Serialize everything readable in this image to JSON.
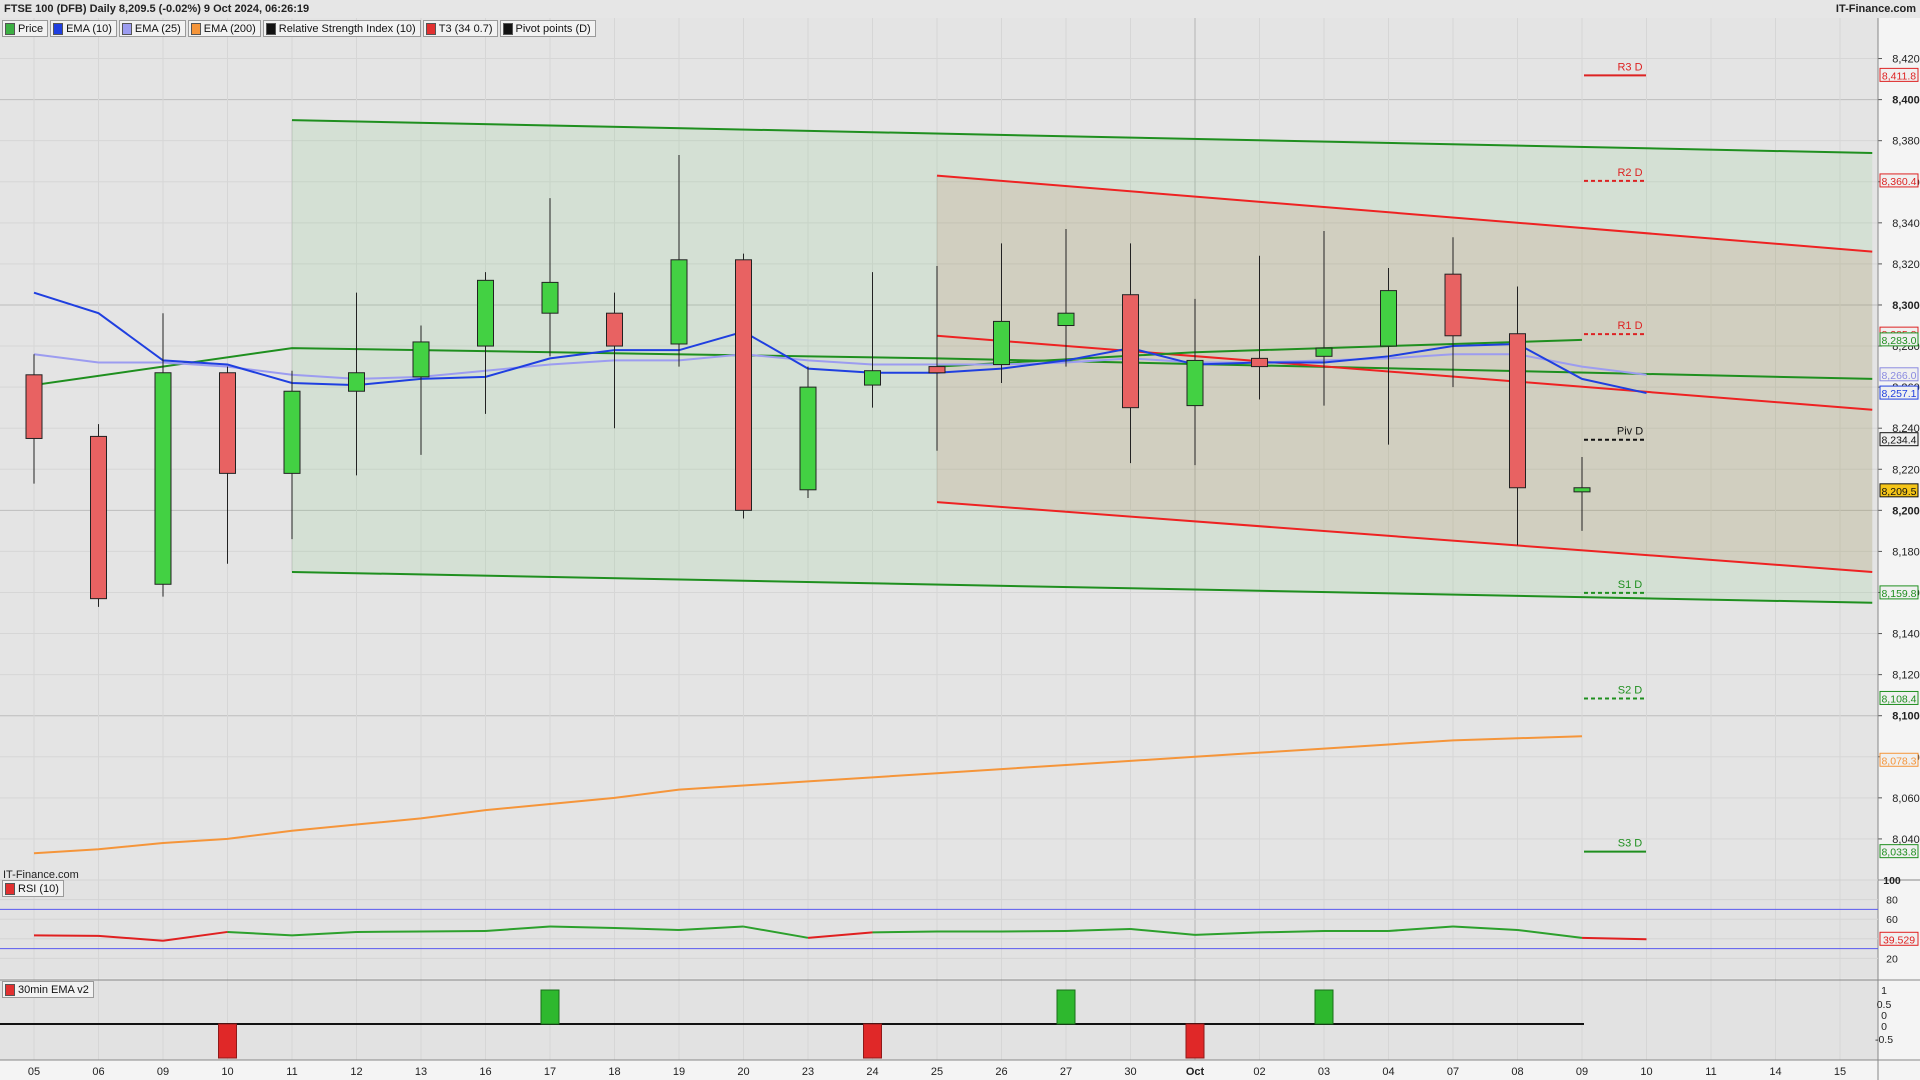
{
  "header": {
    "title": "FTSE 100 (DFB) Daily 8,209.5 (-0.02%) 9 Oct 2024, 06:26:19",
    "brand": "IT-Finance.com",
    "watermark": "IT-Finance.com"
  },
  "legend": [
    {
      "label": "Price",
      "color": "#3cb043"
    },
    {
      "label": "EMA (10)",
      "color": "#1f3fe0"
    },
    {
      "label": "EMA (25)",
      "color": "#9c9cf0"
    },
    {
      "label": "EMA (200)",
      "color": "#f5953a"
    },
    {
      "label": "Relative Strength Index (10)",
      "color": "#111111"
    },
    {
      "label": "T3 (34 0.7)",
      "color": "#e23030"
    },
    {
      "label": "Pivot points (D)",
      "color": "#111111"
    }
  ],
  "rsi_panel": {
    "label": "RSI (10)",
    "ticks": [
      "100",
      "80",
      "60",
      "40",
      "20"
    ],
    "value_label": "39.529"
  },
  "ema_panel": {
    "label": "30min EMA v2",
    "ticks": [
      "1",
      "0.5",
      "0",
      "0",
      "-0.5"
    ]
  },
  "chart_data": {
    "type": "candlestick",
    "price_axis": {
      "min": 8020,
      "max": 8430,
      "ticks": [
        8040,
        8060,
        8080,
        8100,
        8120,
        8140,
        8160,
        8180,
        8200,
        8220,
        8240,
        8260,
        8280,
        8300,
        8320,
        8340,
        8360,
        8380,
        8400,
        8420
      ],
      "tick_labels": [
        "8,040",
        "8,060",
        "8,080",
        "8,100",
        "8,120",
        "8,140",
        "8,160",
        "8,180",
        "8,200",
        "8,220",
        "8,240",
        "8,260",
        "8,280",
        "8,300",
        "8,320",
        "8,340",
        "8,360",
        "8,380",
        "8,400",
        "8,420"
      ],
      "bold_ticks": [
        8100,
        8200,
        8300,
        8400
      ]
    },
    "x_labels": [
      "05",
      "06",
      "09",
      "10",
      "11",
      "12",
      "13",
      "16",
      "17",
      "18",
      "19",
      "20",
      "23",
      "24",
      "25",
      "26",
      "27",
      "30",
      "Oct",
      "02",
      "03",
      "04",
      "07",
      "08",
      "09",
      "10",
      "11",
      "14",
      "15"
    ],
    "candles": [
      {
        "o": 8266,
        "h": 8276,
        "l": 8213,
        "c": 8235
      },
      {
        "o": 8236,
        "h": 8242,
        "l": 8153,
        "c": 8157
      },
      {
        "o": 8164,
        "h": 8296,
        "l": 8158,
        "c": 8267
      },
      {
        "o": 8267,
        "h": 8270,
        "l": 8174,
        "c": 8218
      },
      {
        "o": 8218,
        "h": 8268,
        "l": 8186,
        "c": 8258
      },
      {
        "o": 8258,
        "h": 8306,
        "l": 8217,
        "c": 8267
      },
      {
        "o": 8265,
        "h": 8290,
        "l": 8227,
        "c": 8282
      },
      {
        "o": 8280,
        "h": 8316,
        "l": 8247,
        "c": 8312
      },
      {
        "o": 8296,
        "h": 8352,
        "l": 8275,
        "c": 8311
      },
      {
        "o": 8296,
        "h": 8306,
        "l": 8240,
        "c": 8280
      },
      {
        "o": 8281,
        "h": 8373,
        "l": 8270,
        "c": 8322
      },
      {
        "o": 8322,
        "h": 8325,
        "l": 8196,
        "c": 8200
      },
      {
        "o": 8210,
        "h": 8270,
        "l": 8206,
        "c": 8260
      },
      {
        "o": 8261,
        "h": 8316,
        "l": 8250,
        "c": 8268
      },
      {
        "o": 8270,
        "h": 8319,
        "l": 8229,
        "c": 8267
      },
      {
        "o": 8271,
        "h": 8330,
        "l": 8262,
        "c": 8292
      },
      {
        "o": 8290,
        "h": 8337,
        "l": 8270,
        "c": 8296
      },
      {
        "o": 8305,
        "h": 8330,
        "l": 8223,
        "c": 8250
      },
      {
        "o": 8251,
        "h": 8303,
        "l": 8222,
        "c": 8273
      },
      {
        "o": 8274,
        "h": 8324,
        "l": 8254,
        "c": 8270
      },
      {
        "o": 8275,
        "h": 8336,
        "l": 8251,
        "c": 8279
      },
      {
        "o": 8280,
        "h": 8318,
        "l": 8232,
        "c": 8307
      },
      {
        "o": 8315,
        "h": 8333,
        "l": 8260,
        "c": 8285
      },
      {
        "o": 8286,
        "h": 8309,
        "l": 8183,
        "c": 8211
      },
      {
        "o": 8209,
        "h": 8226,
        "l": 8190,
        "c": 8211
      }
    ],
    "ema10": [
      8306,
      8296,
      8273,
      8271,
      8262,
      8261,
      8264,
      8265,
      8274,
      8278,
      8278,
      8287,
      8269,
      8267,
      8267,
      8269,
      8273,
      8279,
      8271,
      8272,
      8272,
      8275,
      8280,
      8281,
      8264,
      8257.1
    ],
    "ema25": [
      8276,
      8272,
      8272,
      8270,
      8266,
      8264,
      8265,
      8268,
      8271,
      8273,
      8273,
      8276,
      8273,
      8271,
      8271,
      8271,
      8272,
      8274,
      8272,
      8272,
      8273,
      8274,
      8276,
      8276,
      8270,
      8266.0
    ],
    "ema200": [
      8033,
      8035,
      8038,
      8040,
      8044,
      8047,
      8050,
      8054,
      8057,
      8060,
      8064,
      8066,
      8068,
      8070,
      8072,
      8074,
      8076,
      8078,
      8080,
      8082,
      8084,
      8086,
      8088,
      8089,
      8090
    ],
    "channels": [
      {
        "color": "#1f8f1f",
        "fill": "rgba(120,200,120,0.15)",
        "upper": [
          [
            4.0,
            8390
          ],
          [
            28.5,
            8374
          ]
        ],
        "lower": [
          [
            4.0,
            8170
          ],
          [
            28.5,
            8155
          ]
        ]
      },
      {
        "color": "#ee2222",
        "fill": "rgba(190,120,90,0.16)",
        "upper": [
          [
            14.0,
            8363
          ],
          [
            28.5,
            8326
          ]
        ],
        "lower": [
          [
            14.0,
            8204
          ],
          [
            28.5,
            8170
          ]
        ]
      }
    ],
    "lines": [
      {
        "color": "#1f8f1f",
        "points": [
          [
            0.0,
            8261
          ],
          [
            4.0,
            8279
          ],
          [
            14.0,
            8274
          ],
          [
            28.5,
            8264
          ]
        ]
      },
      {
        "color": "#ee2222",
        "points": [
          [
            14.0,
            8285
          ],
          [
            28.5,
            8249
          ]
        ]
      },
      {
        "color": "#1f8f1f",
        "points": [
          [
            14.0,
            8270
          ],
          [
            18.0,
            8277
          ],
          [
            24.0,
            8283
          ]
        ]
      }
    ],
    "pivots": [
      {
        "label": "R3 D",
        "value": 8411.8,
        "value_label": "8,411.8",
        "color": "#dd2222",
        "dashed": false
      },
      {
        "label": "R2 D",
        "value": 8360.4,
        "value_label": "8,360.4",
        "color": "#dd2222",
        "dashed": true
      },
      {
        "label": "R1 D",
        "value": 8285.8,
        "value_label": "8,285.8",
        "color": "#dd2222",
        "dashed": true
      },
      {
        "label": "Piv D",
        "value": 8234.4,
        "value_label": "8,234.4",
        "color": "#111111",
        "dashed": true
      },
      {
        "label": "S1 D",
        "value": 8159.8,
        "value_label": "8,159.8",
        "color": "#1f8f1f",
        "dashed": true
      },
      {
        "label": "S2 D",
        "value": 8108.4,
        "value_label": "8,108.4",
        "color": "#1f8f1f",
        "dashed": true
      },
      {
        "label": "S3 D",
        "value": 8033.8,
        "value_label": "8,033.8",
        "color": "#1f8f1f",
        "dashed": false
      }
    ],
    "price_tags": [
      {
        "value": 8283.0,
        "label": "8,283.0",
        "color": "#1f8f1f",
        "bg": "#f0f0f0"
      },
      {
        "value": 8266.0,
        "label": "8,266.0",
        "color": "#8a8ae0",
        "bg": "#f0f0f0"
      },
      {
        "value": 8257.1,
        "label": "8,257.1",
        "color": "#1f3fe0",
        "bg": "#f0f0f0"
      },
      {
        "value": 8209.5,
        "label": "8,209.5",
        "color": "#111111",
        "bg": "#f5c518"
      },
      {
        "value": 8078.3,
        "label": "8,078.3",
        "color": "#f5953a",
        "bg": "#f0f0f0"
      }
    ],
    "rsi": [
      43.5,
      43.0,
      38.0,
      47.0,
      43.5,
      47.0,
      47.5,
      48.0,
      52.5,
      51.0,
      49.0,
      52.5,
      41.0,
      46.5,
      47.5,
      47.5,
      48.0,
      50.0,
      44.0,
      46.5,
      48.0,
      48.0,
      52.5,
      49.0,
      41.0,
      39.5
    ],
    "rsi_levels": [
      70,
      30
    ],
    "ema_signal": [
      0,
      0,
      0,
      -1,
      0,
      0,
      0,
      0,
      1,
      0,
      0,
      0,
      0,
      -1,
      0,
      0,
      1,
      0,
      -1,
      0,
      1,
      0,
      0,
      0,
      0
    ]
  }
}
